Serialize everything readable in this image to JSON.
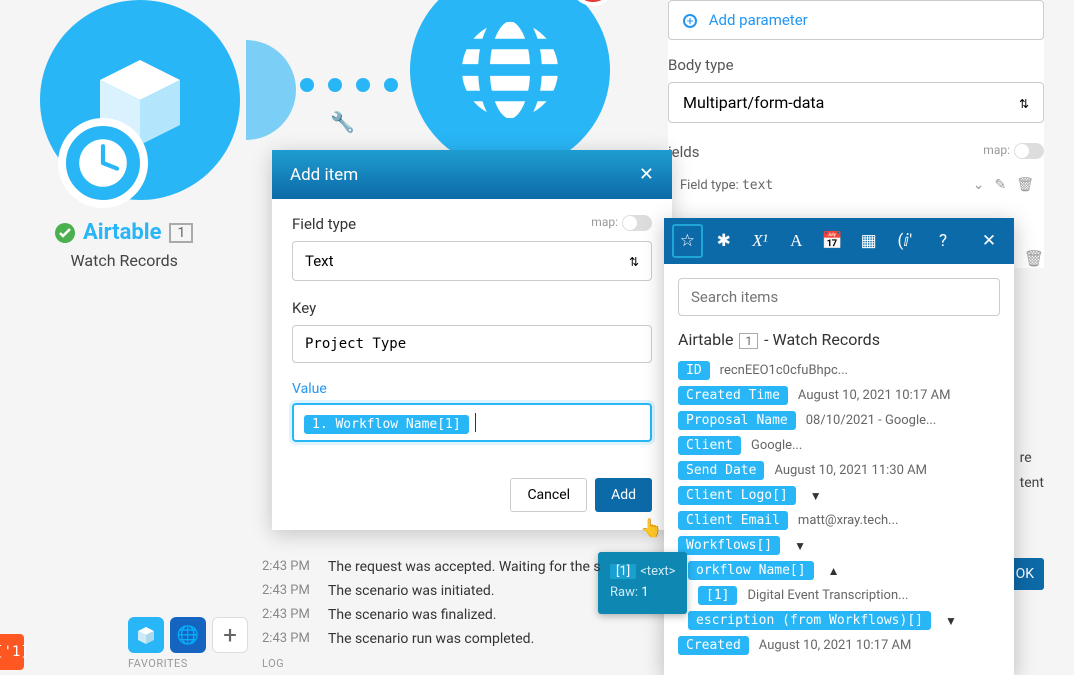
{
  "nodes": {
    "airtable": {
      "title": "Airtable",
      "badge": "1",
      "subtitle": "Watch Records"
    },
    "http": {
      "badge": "!"
    }
  },
  "rightPanel": {
    "addParameter": "Add parameter",
    "bodyTypeLabel": "Body type",
    "bodyTypeValue": "Multipart/form-data",
    "fieldsLabel": "ields",
    "mapLabel": "map:",
    "fieldTypePrefix": "Field type:",
    "fieldTypeVal": "text",
    "cutoff": {
      "a": "re",
      "b": "tent"
    },
    "ok": "OK"
  },
  "modal": {
    "title": "Add item",
    "fieldTypeLabel": "Field type",
    "mapLabel": "map:",
    "fieldTypeValue": "Text",
    "keyLabel": "Key",
    "keyValue": "Project Type",
    "valueLabel": "Value",
    "valuePill": "1. Workflow Name[1]",
    "cancel": "Cancel",
    "add": "Add"
  },
  "picker": {
    "searchPlaceholder": "Search items",
    "headingApp": "Airtable",
    "headingBadge": "1",
    "headingSuffix": " - Watch Records",
    "items": [
      {
        "tag": "ID",
        "val": "recnEEO1c0cfuBhpc..."
      },
      {
        "tag": "Created Time",
        "val": "August 10, 2021 10:17 AM"
      },
      {
        "tag": "Proposal Name",
        "val": "08/10/2021 - Google..."
      },
      {
        "tag": "Client",
        "val": "Google..."
      },
      {
        "tag": "Send Date",
        "val": "August 10, 2021 11:30 AM"
      },
      {
        "tag": "Client Logo[]",
        "caret": "▼"
      },
      {
        "tag": "Client Email",
        "val": "matt@xray.tech..."
      },
      {
        "tag": "Workflows[]",
        "caret": "▼"
      },
      {
        "tag": "orkflow Name[]",
        "caret": "▲",
        "indent": true
      },
      {
        "tag": "[1]",
        "val": "Digital Event Transcription...",
        "indent2": true
      },
      {
        "tag": "escription (from Workflows)[]",
        "caret": "▼",
        "indent": true
      },
      {
        "tag": "Created",
        "val": "August 10, 2021 10:17 AM"
      }
    ]
  },
  "tooltip": {
    "badge": "[1]",
    "type": "<text>",
    "rawLabel": "Raw:",
    "rawVal": "1"
  },
  "log": {
    "rows": [
      {
        "t": "2:43 PM",
        "m": "The request was accepted. Waiting for the s"
      },
      {
        "t": "2:43 PM",
        "m": "The scenario was initiated."
      },
      {
        "t": "2:43 PM",
        "m": "The scenario was finalized."
      },
      {
        "t": "2:43 PM",
        "m": "The scenario run was completed."
      }
    ],
    "label": "LOG"
  },
  "favorites": {
    "label": "FAVORITES"
  }
}
